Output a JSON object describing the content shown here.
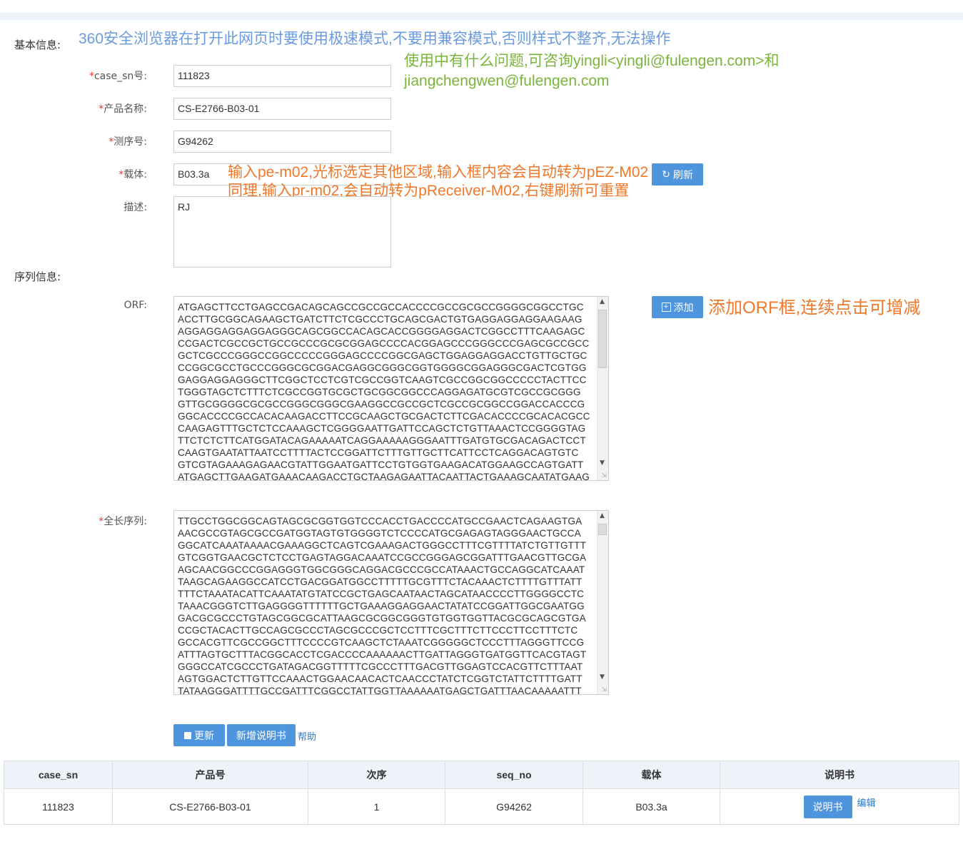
{
  "notes": {
    "browser": "360安全浏览器在打开此网页时要使用极速模式,不要用兼容模式,否则样式不整齐,无法操作",
    "contact_line1": "使用中有什么问题,可咨询yingli<yingli@fulengen.com>和",
    "contact_line2": "jiangchengwen@fulengen.com",
    "vector_line1": "输入pe-m02,光标选定其他区域,输入框内容会自动转为pEZ-M02",
    "vector_line2": "同理,输入pr-m02,会自动转为pReceiver-M02,右键刷新可重置",
    "orf_add": "添加ORF框,连续点击可增减"
  },
  "basic": {
    "section_label": "基本信息:",
    "case_sn_label": "case_sn号:",
    "case_sn_value": "111823",
    "product_label": "产品名称:",
    "product_value": "CS-E2766-B03-01",
    "seq_label": "测序号:",
    "seq_value": "G94262",
    "vector_label": "载体:",
    "vector_value": "B03.3a",
    "refresh_label": "刷新",
    "desc_label": "描述:",
    "desc_value": "RJ"
  },
  "sequence": {
    "section_label": "序列信息:",
    "orf_label": "ORF:",
    "add_label": "添加",
    "orf_lines": [
      "ATGAGCTTCCTGAGCCGACAGCAGCCGCCGCCACCCCGCCGCGCCGGGGCGGCCTGC",
      "ACCTTGCGGCAGAAGCTGATCTTCTCGCCCTGCAGCGACTGTGAGGAGGAGGAAGAAG",
      "AGGAGGAGGAGGAGGGCAGCGGCCACAGCACCGGGGAGGACTCGGCCTTTCAAGAGC",
      "CCGACTCGCCGCTGCCGCCCGCGCGGAGCCCCACGGAGCCCGGGCCCGAGCGCCGCC",
      "GCTCGCCCGGGCCGGCCCCCGGGAGCCCCGGCGAGCTGGAGGAGGACCTGTTGCTGC",
      "CCGGCGCCTGCCCGGGCGCGGACGAGGCGGGCGGTGGGGCGGAGGGCGACTCGTGG",
      "GAGGAGGAGGGCTTCGGCTCCTCGTCGCCGGTCAAGTCGCCGGCGGCCCCCTACTTCC",
      "TGGGTAGCTCTTTCTCGCCGGTGCGCTGCGGCGGCCCAGGAGATGCGTCGCCGCGGG",
      "GTTGCGGGGCGCGCCGGGCGGGCGAAGGCCGCCGCTCGCCGCGGCCGGACCACCCG",
      "GGCACCCCGCCACACAAGACCTTCCGCAAGCTGCGACTCTTCGACACCCCGCACACGCC",
      "CAAGAGTTTGCTCTCCAAAGCTCGGGGAATTGATTCCAGCTCTGTTAAACTCCGGGGTAG",
      "TTCTCTCTTCATGGATACAGAAAAATCAGGAAAAAGGGAATTTGATGTGCGACAGACTCCT",
      "CAAGTGAATATTAATCCTTTTACTCCGGATTCTTTGTTGCTTCATTCCTCAGGACAGTGTC",
      "GTCGTAGAAAGAGAACGTATTGGAATGATTCCTGTGGTGAAGACATGGAAGCCAGTGATT",
      "ATGAGCTTGAAGATGAAACAAGACCTGCTAAGAGAATTACAATTACTGAAAGCAATATGAAG"
    ],
    "full_label": "全长序列:",
    "full_lines": [
      "TTGCCTGGCGGCAGTAGCGCGGTGGTCCCACCTGACCCCATGCCGAACTCAGAAGTGA",
      "AACGCCGTAGCGCCGATGGTAGTGTGGGGTCTCCCCATGCGAGAGTAGGGAACTGCCA",
      "GGCATCAAATAAAACGAAAGGCTCAGTCGAAAGACTGGGCCTTTCGTTTTATCTGTTGTTT",
      "GTCGGTGAACGCTCTCCTGAGTAGGACAAATCCGCCGGGAGCGGATTTGAACGTTGCGA",
      "AGCAACGGCCCGGAGGGTGGCGGGCAGGACGCCCGCCATAAACTGCCAGGCATCAAAT",
      "TAAGCAGAAGGCCATCCTGACGGATGGCCTTTTTGCGTTTCTACAAACTCTTTTGTTTATT",
      "TTTCTAAATACATTCAAATATGTATCCGCTGAGCAATAACTAGCATAACCCCTTGGGGCCTC",
      "TAAACGGGTCTTGAGGGGTTTTTTGCTGAAAGGAGGAACTATATCCGGATTGGCGAATGG",
      "GACGCGCCCTGTAGCGGCGCATTAAGCGCGGCGGGTGTGGTGGTTACGCGCAGCGTGA",
      "CCGCTACACTTGCCAGCGCCCTAGCGCCCGCTCCTTTCGCTTTCTTCCCTTCCTTTCTC",
      "GCCACGTTCGCCGGCTTTCCCCGTCAAGCTCTAAATCGGGGGCTCCCTTTAGGGTTCCG",
      "ATTTAGTGCTTTACGGCACCTCGACCCCAAAAAACTTGATTAGGGTGATGGTTCACGTAGT",
      "GGGCCATCGCCCTGATAGACGGTTTTTCGCCCTTTGACGTTGGAGTCCACGTTCTTTAAT",
      "AGTGGACTCTTGTTCCAAACTGGAACAACACTCAACCCTATCTCGGTCTATTCTTTTGATT",
      "TATAAGGGATTTTGCCGATTTCGGCCTATTGGTTAAAAAATGAGCTGATTTAACAAAAATTT"
    ]
  },
  "actions": {
    "update_label": "更新",
    "new_manual_label": "新增说明书",
    "help_label": "帮助"
  },
  "table": {
    "headers": [
      "case_sn",
      "产品号",
      "次序",
      "seq_no",
      "载体",
      "说明书"
    ],
    "rows": [
      {
        "case_sn": "111823",
        "product": "CS-E2766-B03-01",
        "order": "1",
        "seq_no": "G94262",
        "vector": "B03.3a",
        "manual_btn": "说明书",
        "edit": "编辑"
      }
    ]
  },
  "colors": {
    "accent": "#4f95dd",
    "note_blue": "#6a9ae0",
    "note_green": "#7ab43a",
    "note_orange": "#f0782a",
    "required": "#ee3333"
  }
}
